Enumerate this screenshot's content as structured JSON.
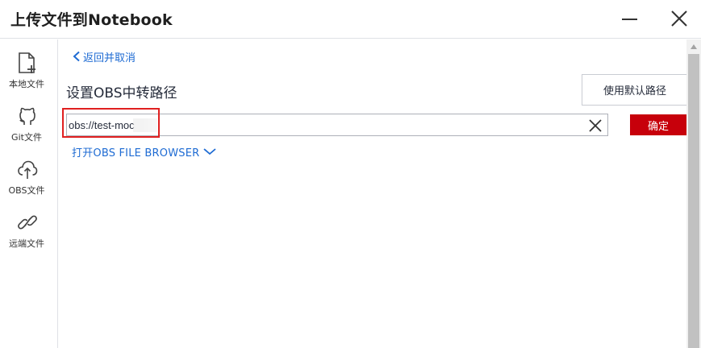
{
  "window": {
    "title": "上传文件到Notebook",
    "minimize_icon": "minimize-icon",
    "close_icon": "close-icon"
  },
  "sidebar": {
    "items": [
      {
        "label": "本地文件",
        "icon": "file-add-icon"
      },
      {
        "label": "Git文件",
        "icon": "github-icon"
      },
      {
        "label": "OBS文件",
        "icon": "cloud-upload-icon"
      },
      {
        "label": "远端文件",
        "icon": "link-icon"
      }
    ]
  },
  "main": {
    "back_label": "返回并取消",
    "section_title": "设置OBS中转路径",
    "default_path_button": "使用默认路径",
    "path_input_value": "obs://test-moc",
    "confirm_button": "确定",
    "browser_toggle_label": "打开OBS FILE BROWSER"
  },
  "colors": {
    "accent_link": "#1e6bd3",
    "confirm_bg": "#c7000b",
    "highlight": "#e02020"
  }
}
